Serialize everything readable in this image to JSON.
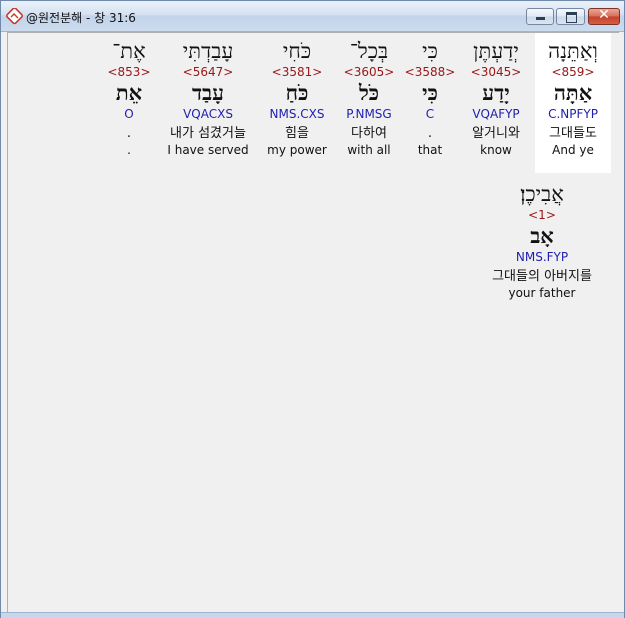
{
  "window": {
    "title": "@원전분해 - 창 31:6",
    "close_glyph": "✕"
  },
  "words": [
    {
      "hebrew": "וְאַתֵּנָה",
      "strong": "<859>",
      "lemma": "אַתָּה",
      "parse": "C.NPFYP",
      "korean": "그대들도",
      "english": "And ye"
    },
    {
      "hebrew": "יְדַעְתֶּן",
      "strong": "<3045>",
      "lemma": "יָדַע",
      "parse": "VQAFYP",
      "korean": "알거니와",
      "english": "know"
    },
    {
      "hebrew": "כִּי",
      "strong": "<3588>",
      "lemma": "כִּי",
      "parse": "C",
      "korean": ".",
      "english": "that"
    },
    {
      "hebrew": "בְּכָל־",
      "strong": "<3605>",
      "lemma": "כֹּל",
      "parse": "P.NMSG",
      "korean": "다하여",
      "english": "with all"
    },
    {
      "hebrew": "כֹּחִי",
      "strong": "<3581>",
      "lemma": "כֹּחַ",
      "parse": "NMS.CXS",
      "korean": "힘을",
      "english": "my power"
    },
    {
      "hebrew": "עָבַדְתִּי",
      "strong": "<5647>",
      "lemma": "עָבַד",
      "parse": "VQACXS",
      "korean": "내가 섬겼거늘",
      "english": "I have served"
    },
    {
      "hebrew": "אֶת־",
      "strong": "<853>",
      "lemma": "אֵת",
      "parse": "O",
      "korean": ".",
      "english": "."
    },
    {
      "hebrew": "אֲבִיכֶן׃",
      "strong": "<1>",
      "lemma": "אָב",
      "parse": "NMS.FYP",
      "korean": "그대들의 아버지를",
      "english": "your father"
    }
  ]
}
